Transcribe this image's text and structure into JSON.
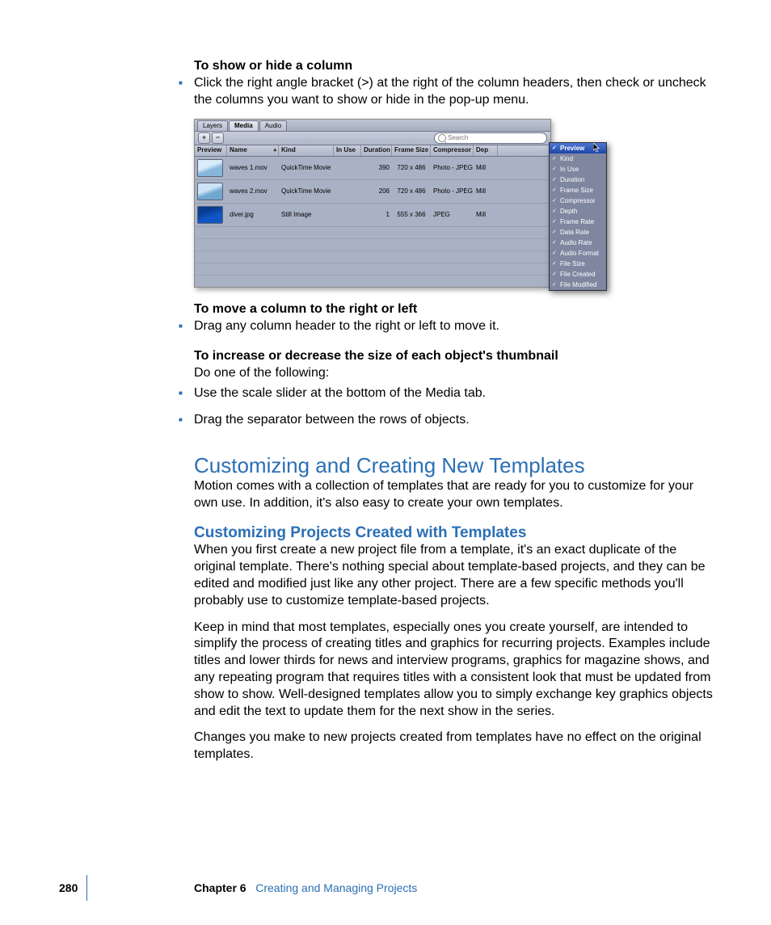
{
  "doc": {
    "h1": "To show or hide a column",
    "b1": "Click the right angle bracket (>) at the right of the column headers, then check or uncheck the columns you want to show or hide in the pop-up menu.",
    "h2": "To move a column to the right or left",
    "b2": "Drag any column header to the right or left to move it.",
    "h3": "To increase or decrease the size of each object's thumbnail",
    "b3sub": "Do one of the following:",
    "b4": "Use the scale slider at the bottom of the Media tab.",
    "b5": "Drag the separator between the rows of objects.",
    "sec1": "Customizing and Creating New Templates",
    "p_sec1": "Motion comes with a collection of templates that are ready for you to customize for your own use. In addition, it's also easy to create your own templates.",
    "sec2": "Customizing Projects Created with Templates",
    "p_sec2a": "When you first create a new project file from a template, it's an exact duplicate of the original template. There's nothing special about template-based projects, and they can be edited and modified just like any other project. There are a few specific methods you'll probably use to customize template-based projects.",
    "p_sec2b": "Keep in mind that most templates, especially ones you create yourself, are intended to simplify the process of creating titles and graphics for recurring projects. Examples include titles and lower thirds for news and interview programs, graphics for magazine shows, and any repeating program that requires titles with a consistent look that must be updated from show to show. Well-designed templates allow you to simply exchange key graphics objects and edit the text to update them for the next show in the series.",
    "p_sec2c": "Changes you make to new projects created from templates have no effect on the original templates."
  },
  "footer": {
    "page": "280",
    "chapter_label": "Chapter 6",
    "chapter_title": "Creating and Managing Projects"
  },
  "panel": {
    "tabs": {
      "layers": "Layers",
      "media": "Media",
      "audio": "Audio"
    },
    "plus": "+",
    "minus": "−",
    "search_placeholder": "Search",
    "cols": {
      "preview": "Preview",
      "name": "Name",
      "kind": "Kind",
      "inuse": "In Use",
      "duration": "Duration",
      "frame": "Frame Size",
      "comp": "Compressor",
      "dep": "Dep"
    },
    "rows": [
      {
        "name": "waves 1.mov",
        "kind": "QuickTime Movie",
        "dur": "390",
        "frame": "720 x 486",
        "comp": "Photo - JPEG",
        "dep": "Mill"
      },
      {
        "name": "waves 2.mov",
        "kind": "QuickTime Movie",
        "dur": "206",
        "frame": "720 x 486",
        "comp": "Photo - JPEG",
        "dep": "Mill"
      },
      {
        "name": "diver.jpg",
        "kind": "Still Image",
        "dur": "1",
        "frame": "555 x 366",
        "comp": "JPEG",
        "dep": "Mill"
      }
    ],
    "menu": [
      "Preview",
      "Kind",
      "In Use",
      "Duration",
      "Frame Size",
      "Compressor",
      "Depth",
      "Frame Rate",
      "Data Rate",
      "Audio Rate",
      "Audio Format",
      "File Size",
      "File Created",
      "File Modified"
    ]
  }
}
